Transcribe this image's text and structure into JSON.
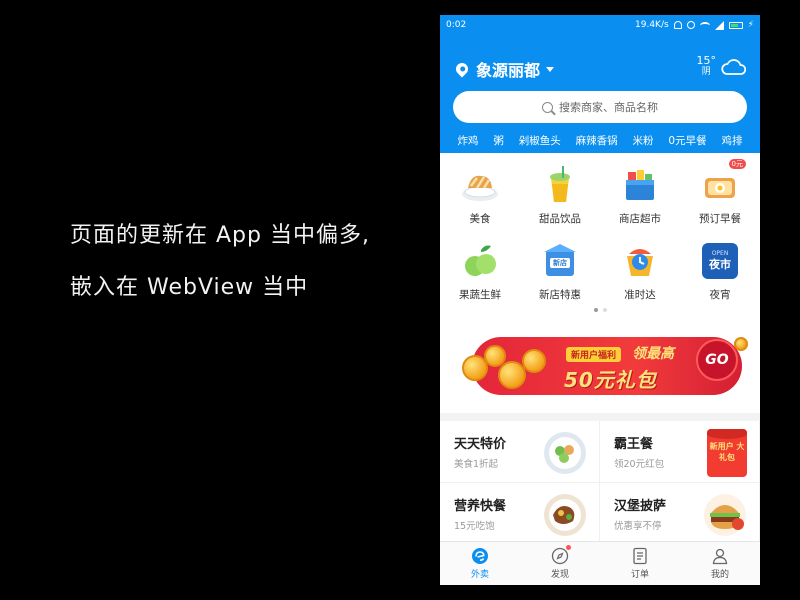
{
  "caption": {
    "line1": "页面的更新在 App 当中偏多,",
    "line2": "嵌入在 WebView 当中"
  },
  "status_bar": {
    "time": "0:02",
    "speed": "19.4K/s"
  },
  "header": {
    "location": "象源丽都",
    "weather_temp": "15°",
    "weather_cond": "阴",
    "weather_icon": "cloud-icon",
    "search_placeholder": "搜索商家、商品名称",
    "hot_words": [
      "炸鸡",
      "粥",
      "剁椒鱼头",
      "麻辣香锅",
      "米粉",
      "0元早餐",
      "鸡排"
    ]
  },
  "categories": [
    {
      "label": "美食",
      "icon": "food-icon"
    },
    {
      "label": "甜品饮品",
      "icon": "drink-icon"
    },
    {
      "label": "商店超市",
      "icon": "market-icon"
    },
    {
      "label": "预订早餐",
      "icon": "breakfast-icon",
      "badge": "0元"
    },
    {
      "label": "果蔬生鲜",
      "icon": "fruit-icon"
    },
    {
      "label": "新店特惠",
      "icon": "new-store-icon",
      "icon_text": "新店"
    },
    {
      "label": "准时达",
      "icon": "ontime-icon"
    },
    {
      "label": "夜宵",
      "icon": "night-icon",
      "icon_text_top": "OPEN",
      "icon_text": "夜市"
    }
  ],
  "banner": {
    "tag": "新用户福利",
    "subtitle": "领最高",
    "main": "50元礼包",
    "go": "GO"
  },
  "promos": [
    {
      "title": "天天特价",
      "sub": "美食1折起"
    },
    {
      "title": "霸王餐",
      "sub": "领20元红包",
      "image_text": "新用户 大礼包"
    },
    {
      "title": "营养快餐",
      "sub": "15元吃饱"
    },
    {
      "title": "汉堡披萨",
      "sub": "优惠享不停"
    }
  ],
  "tabs": [
    {
      "label": "外卖",
      "active": true
    },
    {
      "label": "发现",
      "active": false
    },
    {
      "label": "订单",
      "active": false
    },
    {
      "label": "我的",
      "active": false
    }
  ],
  "colors": {
    "brand_blue": "#0a8ff0",
    "banner_red": "#f23b3b",
    "coin_gold": "#f4a11a"
  }
}
